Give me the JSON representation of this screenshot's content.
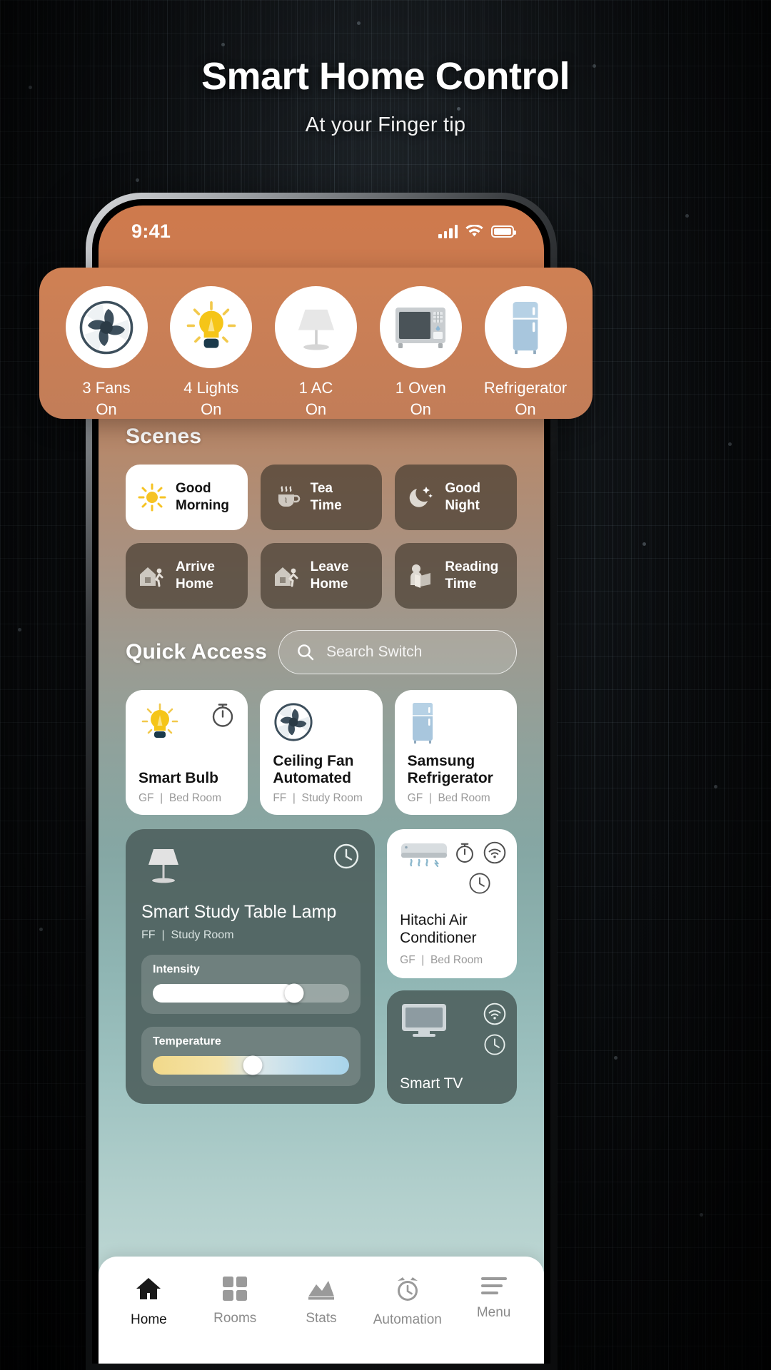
{
  "hero": {
    "title": "Smart Home Control",
    "subtitle": "At your Finger tip"
  },
  "status_bar": {
    "time": "9:41",
    "signal_icon": "cellular-bars-icon",
    "wifi_icon": "wifi-icon",
    "battery_icon": "battery-full-icon"
  },
  "device_strip": {
    "items": [
      {
        "icon": "fan-icon",
        "count_label": "3 Fans",
        "state": "On"
      },
      {
        "icon": "lightbulb-icon",
        "count_label": "4 Lights",
        "state": "On"
      },
      {
        "icon": "table-lamp-icon",
        "count_label": "1 AC",
        "state": "On"
      },
      {
        "icon": "microwave-icon",
        "count_label": "1 Oven",
        "state": "On"
      },
      {
        "icon": "refrigerator-icon",
        "count_label": "Refrigerator",
        "state": "On"
      }
    ]
  },
  "scenes": {
    "title": "Scenes",
    "items": [
      {
        "label_line1": "Good",
        "label_line2": "Morning",
        "icon": "sun-icon",
        "active": true
      },
      {
        "label_line1": "Tea",
        "label_line2": "Time",
        "icon": "tea-cup-icon",
        "active": false
      },
      {
        "label_line1": "Good",
        "label_line2": "Night",
        "icon": "moon-stars-icon",
        "active": false
      },
      {
        "label_line1": "Arrive",
        "label_line2": "Home",
        "icon": "arrive-home-icon",
        "active": false
      },
      {
        "label_line1": "Leave",
        "label_line2": "Home",
        "icon": "leave-home-icon",
        "active": false
      },
      {
        "label_line1": "Reading",
        "label_line2": "Time",
        "icon": "reading-icon",
        "active": false
      }
    ]
  },
  "quick_access": {
    "title": "Quick Access",
    "search": {
      "placeholder": "Search Switch",
      "value": "",
      "icon": "search-icon"
    },
    "cards": [
      {
        "name": "Smart Bulb",
        "floor": "GF",
        "separator": "|",
        "room": "Bed Room",
        "device_icon": "lightbulb-icon",
        "badges": [
          "timer-icon"
        ]
      },
      {
        "name_line1": "Ceiling Fan",
        "name_line2": "Automated",
        "name": "Ceiling Fan Automated",
        "floor": "FF",
        "separator": "|",
        "room": "Study Room",
        "device_icon": "fan-icon",
        "badges": []
      },
      {
        "name_line1": "Samsung",
        "name_line2": "Refrigerator",
        "name": "Samsung Refrigerator",
        "floor": "GF",
        "separator": "|",
        "room": "Bed Room",
        "device_icon": "refrigerator-icon",
        "badges": []
      }
    ]
  },
  "lamp_card": {
    "name": "Smart Study Table Lamp",
    "floor": "FF",
    "separator": "|",
    "room": "Study Room",
    "device_icon": "table-lamp-icon",
    "badges": [
      "clock-icon"
    ],
    "sliders": [
      {
        "label": "Intensity",
        "value_percent": 72,
        "type": "plain"
      },
      {
        "label": "Temperature",
        "value_percent": 51,
        "type": "gradient"
      }
    ]
  },
  "ac_card": {
    "name_line1": "Hitachi Air",
    "name_line2": "Conditioner",
    "name": "Hitachi Air Conditioner",
    "floor": "GF",
    "separator": "|",
    "room": "Bed Room",
    "device_icon": "air-conditioner-icon",
    "badges": [
      "timer-icon",
      "wifi-icon",
      "clock-icon"
    ]
  },
  "tv_card": {
    "name": "Smart TV",
    "device_icon": "television-icon",
    "badges": [
      "wifi-icon",
      "clock-icon"
    ]
  },
  "tabbar": {
    "items": [
      {
        "label": "Home",
        "icon": "home-icon",
        "active": true
      },
      {
        "label": "Rooms",
        "icon": "grid-icon",
        "active": false
      },
      {
        "label": "Stats",
        "icon": "chart-icon",
        "active": false
      },
      {
        "label": "Automation",
        "icon": "alarm-clock-icon",
        "active": false
      },
      {
        "label": "Menu",
        "icon": "hamburger-icon",
        "active": false
      }
    ]
  },
  "colors": {
    "accent_orange": "#cf8054",
    "card_white": "#ffffff",
    "scene_dark": "#4a4034",
    "teal_card": "#4f6260",
    "bulb_yellow": "#f5c518"
  }
}
